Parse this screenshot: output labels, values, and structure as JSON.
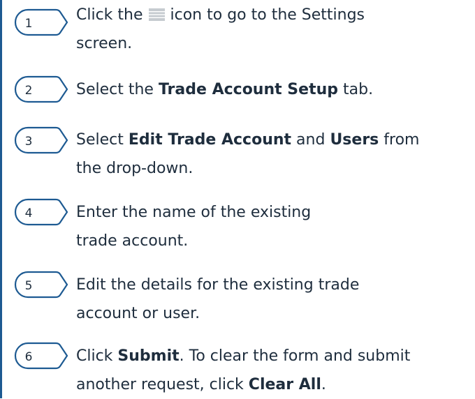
{
  "colors": {
    "marker_stroke": "#1d5a92",
    "text": "#1e2d3d",
    "menu_icon": "#c6cbd0",
    "edge_rule": "#1d5a92"
  },
  "steps": [
    {
      "number": "1",
      "parts": [
        {
          "text": "Click the "
        },
        {
          "icon": "menu-icon"
        },
        {
          "text": " icon to go to the Settings"
        },
        {
          "break": true
        },
        {
          "text": "screen."
        }
      ]
    },
    {
      "number": "2",
      "parts": [
        {
          "text": "Select the "
        },
        {
          "bold": "Trade Account Setup"
        },
        {
          "text": " tab."
        }
      ]
    },
    {
      "number": "3",
      "parts": [
        {
          "text": "Select "
        },
        {
          "bold": "Edit Trade Account"
        },
        {
          "text": " and "
        },
        {
          "bold": "Users"
        },
        {
          "text": " from"
        },
        {
          "break": true
        },
        {
          "text": "the drop-down."
        }
      ]
    },
    {
      "number": "4",
      "parts": [
        {
          "text": "Enter the name of the existing"
        },
        {
          "break": true
        },
        {
          "text": "trade account."
        }
      ]
    },
    {
      "number": "5",
      "parts": [
        {
          "text": "Edit the details for the existing trade"
        },
        {
          "break": true
        },
        {
          "text": "account or user."
        }
      ]
    },
    {
      "number": "6",
      "parts": [
        {
          "text": "Click "
        },
        {
          "bold": "Submit"
        },
        {
          "text": ". To clear the form and submit"
        },
        {
          "break": true
        },
        {
          "text": "another request, click "
        },
        {
          "bold": "Clear All"
        },
        {
          "text": "."
        }
      ]
    }
  ]
}
